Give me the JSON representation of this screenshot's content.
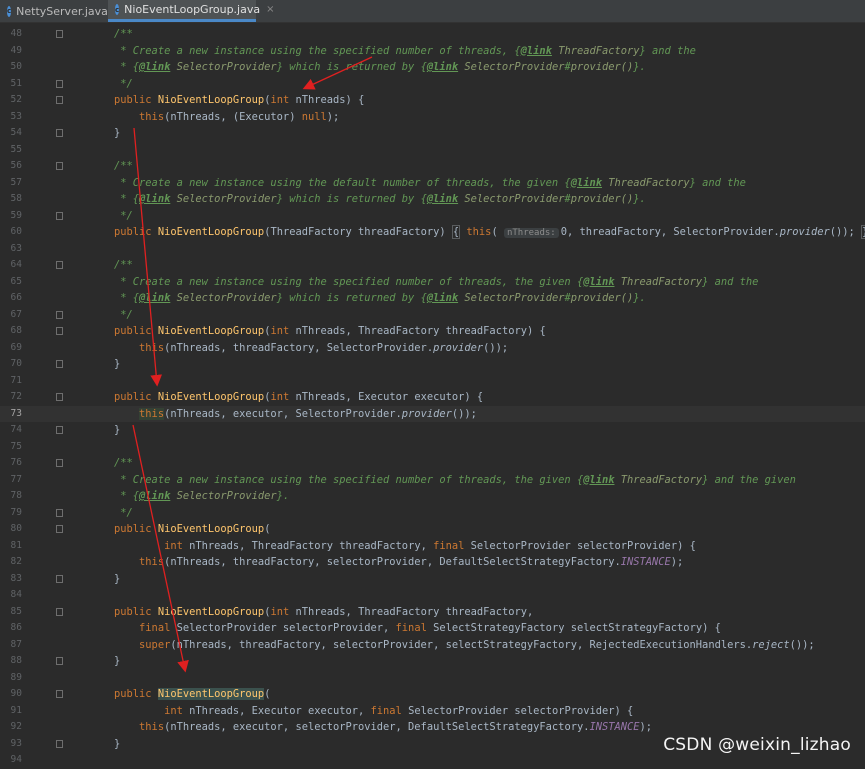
{
  "tabs": [
    {
      "label": "NettyServer.java",
      "icon": "java-class-icon",
      "color": "#4a8fd6",
      "active": false
    },
    {
      "label": "NioEventLoopGroup.java",
      "icon": "java-class-icon",
      "color": "#4a8fd6",
      "active": true,
      "close": "×"
    }
  ],
  "editor": {
    "current_line": "73",
    "lines": [
      {
        "n": "48",
        "t": "    /**"
      },
      {
        "n": "49",
        "t": "     * Create a new instance using the specified number of threads, {@link ThreadFactory} and the"
      },
      {
        "n": "50",
        "t": "     * {@link SelectorProvider} which is returned by {@link SelectorProvider#provider()}."
      },
      {
        "n": "51",
        "t": "     */"
      },
      {
        "n": "52",
        "t": "    public NioEventLoopGroup(int nThreads) {"
      },
      {
        "n": "53",
        "t": "        this(nThreads, (Executor) null);"
      },
      {
        "n": "54",
        "t": "    }"
      },
      {
        "n": "55",
        "t": ""
      },
      {
        "n": "56",
        "t": "    /**"
      },
      {
        "n": "57",
        "t": "     * Create a new instance using the default number of threads, the given {@link ThreadFactory} and the"
      },
      {
        "n": "58",
        "t": "     * {@link SelectorProvider} which is returned by {@link SelectorProvider#provider()}."
      },
      {
        "n": "59",
        "t": "     */"
      },
      {
        "n": "60",
        "t": "    public NioEventLoopGroup(ThreadFactory threadFactory) { this( nThreads: 0, threadFactory, SelectorProvider.provider()); }"
      },
      {
        "n": "63",
        "t": ""
      },
      {
        "n": "64",
        "t": "    /**"
      },
      {
        "n": "65",
        "t": "     * Create a new instance using the specified number of threads, the given {@link ThreadFactory} and the"
      },
      {
        "n": "66",
        "t": "     * {@link SelectorProvider} which is returned by {@link SelectorProvider#provider()}."
      },
      {
        "n": "67",
        "t": "     */"
      },
      {
        "n": "68",
        "t": "    public NioEventLoopGroup(int nThreads, ThreadFactory threadFactory) {"
      },
      {
        "n": "69",
        "t": "        this(nThreads, threadFactory, SelectorProvider.provider());"
      },
      {
        "n": "70",
        "t": "    }"
      },
      {
        "n": "71",
        "t": ""
      },
      {
        "n": "72",
        "t": "    public NioEventLoopGroup(int nThreads, Executor executor) {"
      },
      {
        "n": "73",
        "t": "        this(nThreads, executor, SelectorProvider.provider());"
      },
      {
        "n": "74",
        "t": "    }"
      },
      {
        "n": "75",
        "t": ""
      },
      {
        "n": "76",
        "t": "    /**"
      },
      {
        "n": "77",
        "t": "     * Create a new instance using the specified number of threads, the given {@link ThreadFactory} and the given"
      },
      {
        "n": "78",
        "t": "     * {@link SelectorProvider}."
      },
      {
        "n": "79",
        "t": "     */"
      },
      {
        "n": "80",
        "t": "    public NioEventLoopGroup("
      },
      {
        "n": "81",
        "t": "            int nThreads, ThreadFactory threadFactory, final SelectorProvider selectorProvider) {"
      },
      {
        "n": "82",
        "t": "        this(nThreads, threadFactory, selectorProvider, DefaultSelectStrategyFactory.INSTANCE);"
      },
      {
        "n": "83",
        "t": "    }"
      },
      {
        "n": "84",
        "t": ""
      },
      {
        "n": "85",
        "t": "    public NioEventLoopGroup(int nThreads, ThreadFactory threadFactory,"
      },
      {
        "n": "86",
        "t": "        final SelectorProvider selectorProvider, final SelectStrategyFactory selectStrategyFactory) {"
      },
      {
        "n": "87",
        "t": "        super(nThreads, threadFactory, selectorProvider, selectStrategyFactory, RejectedExecutionHandlers.reject());"
      },
      {
        "n": "88",
        "t": "    }"
      },
      {
        "n": "89",
        "t": ""
      },
      {
        "n": "90",
        "t": "    public NioEventLoopGroup("
      },
      {
        "n": "91",
        "t": "            int nThreads, Executor executor, final SelectorProvider selectorProvider) {"
      },
      {
        "n": "92",
        "t": "        this(nThreads, executor, selectorProvider, DefaultSelectStrategyFactory.INSTANCE);"
      },
      {
        "n": "93",
        "t": "    }"
      },
      {
        "n": "94",
        "t": ""
      }
    ]
  },
  "colors": {
    "background": "#2b2b2b",
    "keyword": "#cc7832",
    "method": "#ffc66d",
    "javadoc": "#629755",
    "static_field": "#9876aa",
    "text": "#a9b7c6",
    "arrow": "#e02020"
  },
  "watermark": "CSDN @weixin_lizhao"
}
